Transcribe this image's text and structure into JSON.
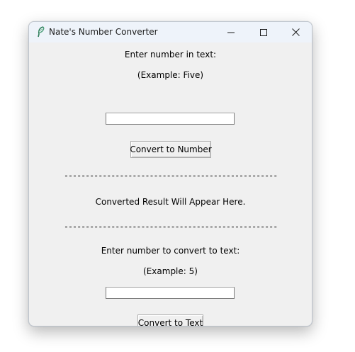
{
  "window": {
    "title": "Nate's Number Converter",
    "icon": "feather-icon",
    "controls": [
      "minimize-icon",
      "maximize-icon",
      "close-icon"
    ]
  },
  "text_to_number": {
    "prompt": "Enter number in text:",
    "example": "(Example: Five)",
    "input_value": "",
    "button_label": "Convert to Number"
  },
  "divider_text": "--------------------------------------------------",
  "result": {
    "text": "Converted Result Will Appear Here."
  },
  "number_to_text": {
    "prompt": "Enter number to convert to text:",
    "example": "(Example: 5)",
    "input_value": "",
    "button_label": "Convert to Text"
  }
}
